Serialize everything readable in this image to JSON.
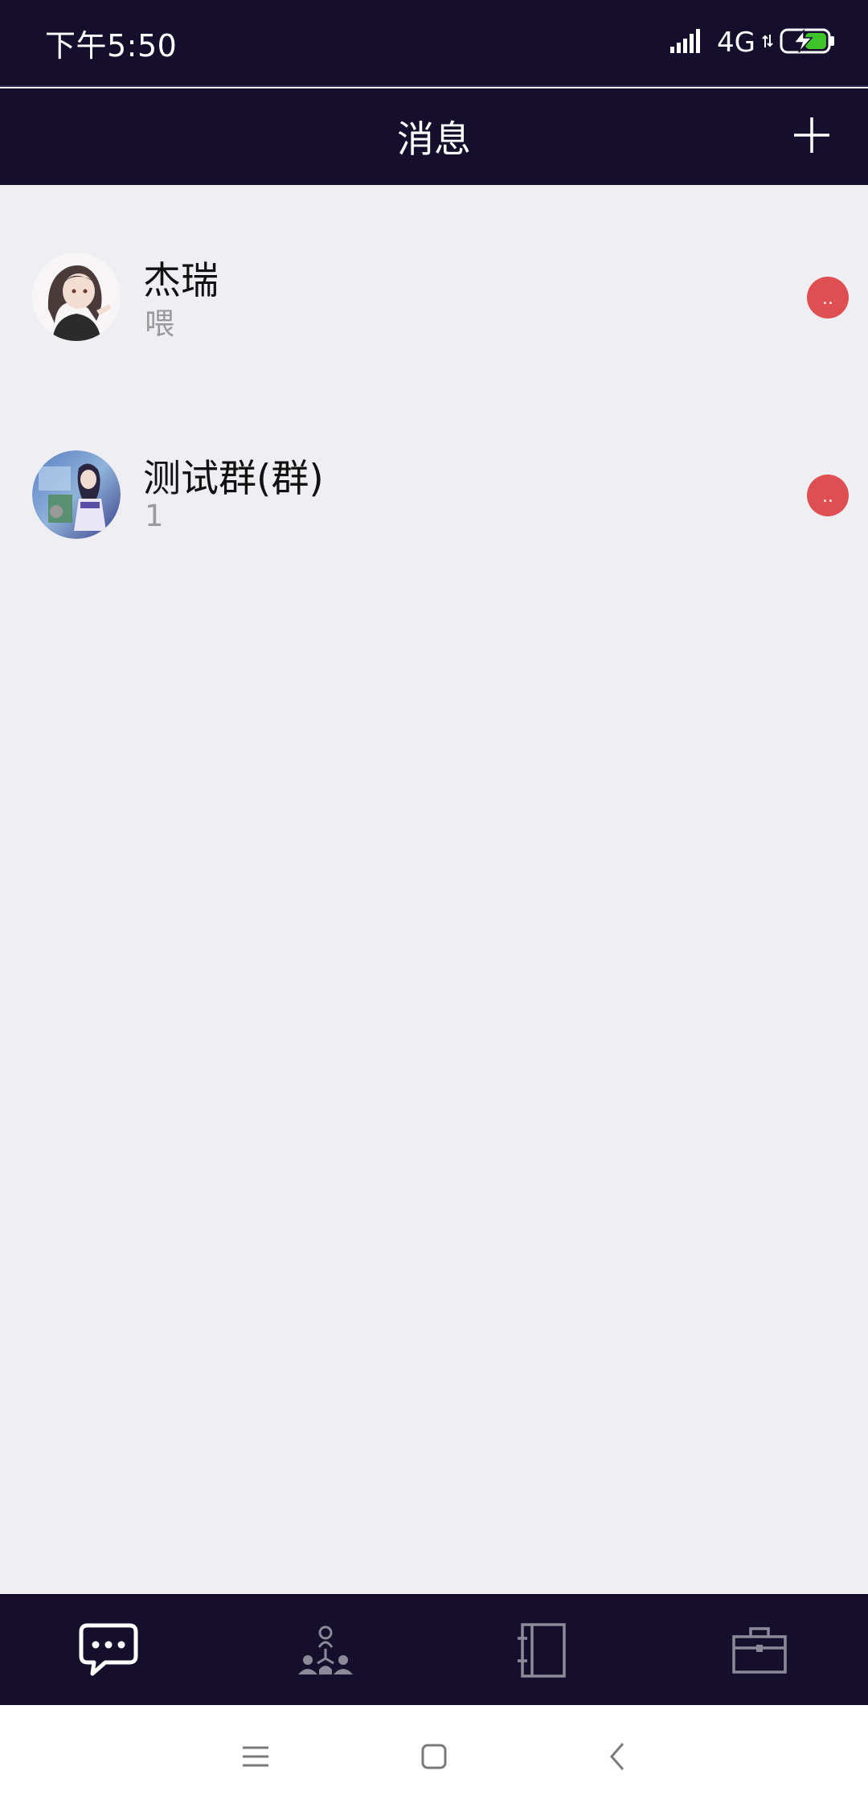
{
  "status_bar": {
    "time": "下午5:50",
    "network": "4G"
  },
  "header": {
    "title": "消息"
  },
  "conversations": [
    {
      "name": "杰瑞",
      "preview": "喂",
      "badge": ".."
    },
    {
      "name": "测试群(群)",
      "preview": "1",
      "badge": ".."
    }
  ],
  "tabs": [
    {
      "icon": "chat-bubble-icon",
      "active": true
    },
    {
      "icon": "organization-icon",
      "active": false
    },
    {
      "icon": "contacts-book-icon",
      "active": false
    },
    {
      "icon": "briefcase-icon",
      "active": false
    }
  ],
  "colors": {
    "header_bg": "#150f2d",
    "page_bg": "#efeef3",
    "badge": "#df4f51",
    "tab_active": "#ffffff",
    "tab_inactive": "#8c8a99"
  }
}
